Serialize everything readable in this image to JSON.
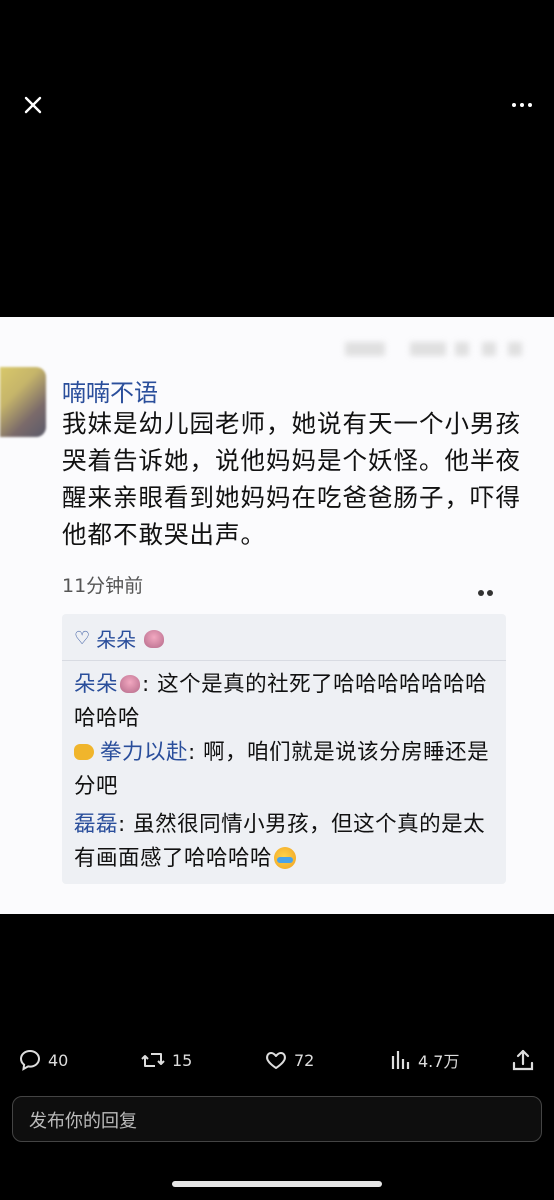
{
  "post": {
    "username": "喃喃不语",
    "text": "我妹是幼儿园老师，她说有天一个小男孩哭着告诉她，说他妈妈是个妖怪。他半夜醒来亲眼看到她妈妈在吃爸爸肠子，吓得他都不敢哭出声。",
    "time": "11分钟前"
  },
  "likes": {
    "name": "朵朵"
  },
  "comments": [
    {
      "author": "朵朵",
      "text": ": 这个是真的社死了哈哈哈哈哈哈哈哈哈哈"
    },
    {
      "author": "拳力以赴",
      "text": ": 啊，咱们就是说该分房睡还是分吧"
    },
    {
      "author": "磊磊",
      "text": ": 虽然很同情小男孩，但这个真的是太有画面感了哈哈哈哈"
    }
  ],
  "actions": {
    "replies": "40",
    "reposts": "15",
    "likes": "72",
    "views": "4.7万"
  },
  "reply_placeholder": "发布你的回复"
}
